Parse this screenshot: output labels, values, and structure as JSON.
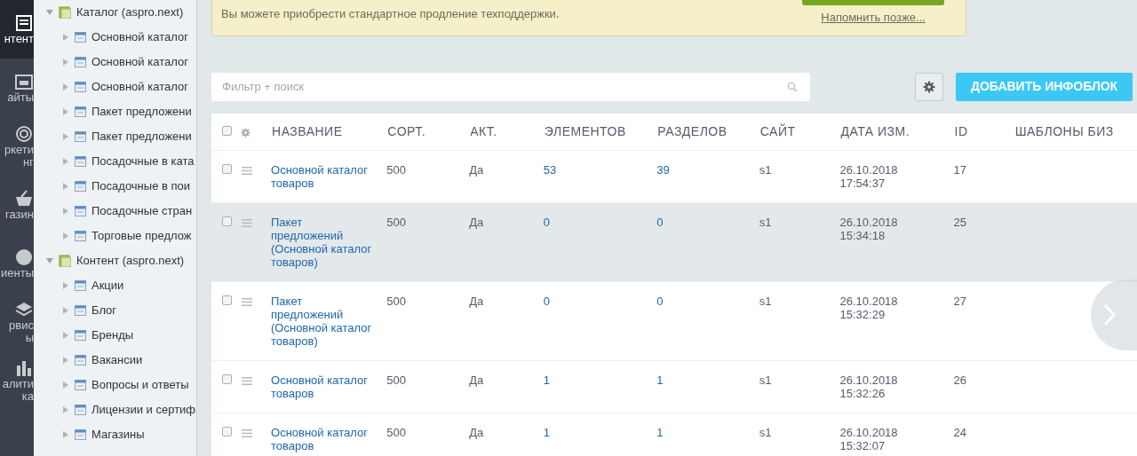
{
  "left_nav": [
    {
      "label": "нтент",
      "selected": true
    },
    {
      "label": "айты",
      "selected": false
    },
    {
      "label": "ркети нг",
      "selected": false
    },
    {
      "label": "газин",
      "selected": false
    },
    {
      "label": "иенты",
      "selected": false
    },
    {
      "label": "рвис ы",
      "selected": false
    },
    {
      "label": "алити ка",
      "selected": false
    }
  ],
  "tree": [
    {
      "label": "Каталог (aspro.next)",
      "kind": "group",
      "expanded": true,
      "children": [
        {
          "label": "Основной каталог",
          "kind": "block",
          "expanded": false
        },
        {
          "label": "Основной каталог",
          "kind": "block",
          "expanded": false
        },
        {
          "label": "Основной каталог",
          "kind": "block",
          "expanded": false
        },
        {
          "label": "Пакет предложени",
          "kind": "block",
          "expanded": false
        },
        {
          "label": "Пакет предложени",
          "kind": "block",
          "expanded": false
        },
        {
          "label": "Посадочные в ката",
          "kind": "block",
          "expanded": false
        },
        {
          "label": "Посадочные в пои",
          "kind": "block",
          "expanded": false
        },
        {
          "label": "Посадочные стран",
          "kind": "block",
          "expanded": false
        },
        {
          "label": "Торговые предлож",
          "kind": "block",
          "expanded": false
        }
      ]
    },
    {
      "label": "Контент (aspro.next)",
      "kind": "group",
      "expanded": true,
      "children": [
        {
          "label": "Акции",
          "kind": "block",
          "expanded": false
        },
        {
          "label": "Блог",
          "kind": "block",
          "expanded": false
        },
        {
          "label": "Бренды",
          "kind": "block",
          "expanded": false
        },
        {
          "label": "Вакансии",
          "kind": "block",
          "expanded": false
        },
        {
          "label": "Вопросы и ответы",
          "kind": "block",
          "expanded": false
        },
        {
          "label": "Лицензии и сертиф",
          "kind": "block",
          "expanded": false
        },
        {
          "label": "Магазины",
          "kind": "block",
          "expanded": false
        }
      ]
    }
  ],
  "notice": {
    "text": "Вы можете приобрести стандартное продление техподдержки.",
    "remind_link": "Напомнить позже..."
  },
  "filter": {
    "placeholder": "Фильтр + поиск"
  },
  "add_button": "ДОБАВИТЬ ИНФОБЛОК",
  "table": {
    "select_all_checked": false,
    "columns": [
      "НАЗВАНИЕ",
      "СОРТ.",
      "АКТ.",
      "ЭЛЕМЕНТОВ",
      "РАЗДЕЛОВ",
      "САЙТ",
      "ДАТА ИЗМ.",
      "ID",
      "ШАБЛОНЫ БИЗ"
    ],
    "rows": [
      {
        "selected": false,
        "hover": false,
        "cells": [
          "Основной каталог товаров",
          "500",
          "Да",
          "53",
          "39",
          "s1",
          "26.10.2018 17:54:37",
          "17"
        ]
      },
      {
        "selected": false,
        "hover": true,
        "cells": [
          "Пакет предложений (Основной каталог товаров)",
          "500",
          "Да",
          "0",
          "0",
          "s1",
          "26.10.2018 15:34:18",
          "25"
        ]
      },
      {
        "selected": false,
        "hover": false,
        "cells": [
          "Пакет предложений (Основной каталог товаров)",
          "500",
          "Да",
          "0",
          "0",
          "s1",
          "26.10.2018 15:32:29",
          "27"
        ]
      },
      {
        "selected": false,
        "hover": false,
        "cells": [
          "Основной каталог товаров",
          "500",
          "Да",
          "1",
          "1",
          "s1",
          "26.10.2018 15:32:26",
          "26"
        ]
      },
      {
        "selected": false,
        "hover": false,
        "cells": [
          "Основной каталог товаров",
          "500",
          "Да",
          "1",
          "1",
          "s1",
          "26.10.2018 15:32:07",
          "24"
        ]
      }
    ]
  }
}
